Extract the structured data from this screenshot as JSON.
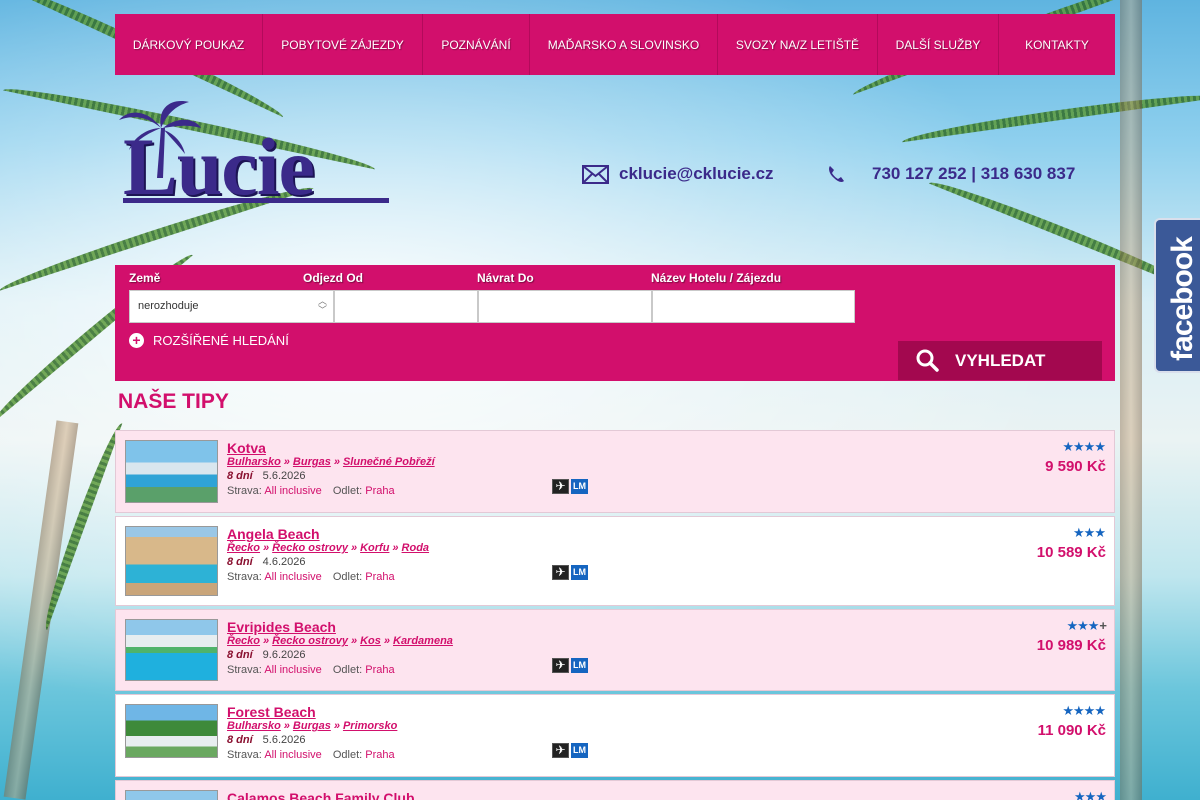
{
  "nav": {
    "items": [
      "DÁRKOVÝ POUKAZ",
      "POBYTOVÉ ZÁJEZDY",
      "POZNÁVÁNÍ",
      "MAĎARSKO A SLOVINSKO",
      "SVOZY NA/Z LETIŠTĚ",
      "DALŠÍ SLUŽBY",
      "KONTAKTY"
    ]
  },
  "logo": {
    "text": "Lucie"
  },
  "contact": {
    "email": "cklucie@cklucie.cz",
    "phone": "730 127 252 | 318 630 837"
  },
  "facebook": {
    "label": "facebook"
  },
  "search": {
    "labels": {
      "country": "Země",
      "depart": "Odjezd Od",
      "return": "Návrat Do",
      "hotel": "Název Hotelu / Zájezdu"
    },
    "country_value": "nerozhoduje",
    "advanced_label": "ROZŠÍŘENÉ HLEDÁNÍ",
    "button_label": "VYHLEDAT"
  },
  "tips": {
    "title": "NAŠE TIPY",
    "items": [
      {
        "name": "Kotva",
        "path": [
          "Bulharsko",
          "Burgas",
          "Slunečné Pobřeží"
        ],
        "days": "8 dní",
        "date": "5.6.2026",
        "board_label": "Strava:",
        "board": "All inclusive",
        "departure_label": "Odlet:",
        "departure": "Praha",
        "stars": "★★★★",
        "plus": "",
        "price": "9 590 Kč"
      },
      {
        "name": "Angela Beach",
        "path": [
          "Řecko",
          "Řecko ostrovy",
          "Korfu",
          "Roda"
        ],
        "days": "8 dní",
        "date": "4.6.2026",
        "board_label": "Strava:",
        "board": "All inclusive",
        "departure_label": "Odlet:",
        "departure": "Praha",
        "stars": "★★★",
        "plus": "",
        "price": "10 589 Kč"
      },
      {
        "name": "Evripides Beach",
        "path": [
          "Řecko",
          "Řecko ostrovy",
          "Kos",
          "Kardamena"
        ],
        "days": "8 dní",
        "date": "9.6.2026",
        "board_label": "Strava:",
        "board": "All inclusive",
        "departure_label": "Odlet:",
        "departure": "Praha",
        "stars": "★★★",
        "plus": "+",
        "price": "10 989 Kč"
      },
      {
        "name": "Forest Beach",
        "path": [
          "Bulharsko",
          "Burgas",
          "Primorsko"
        ],
        "days": "8 dní",
        "date": "5.6.2026",
        "board_label": "Strava:",
        "board": "All inclusive",
        "departure_label": "Odlet:",
        "departure": "Praha",
        "stars": "★★★★",
        "plus": "",
        "price": "11 090 Kč"
      },
      {
        "name": "Calamos Beach Family Club",
        "path": [],
        "days": "",
        "date": "",
        "board_label": "",
        "board": "",
        "departure_label": "",
        "departure": "",
        "stars": "★★★",
        "plus": "",
        "price": ""
      }
    ]
  },
  "icons": {
    "flight": "airplane-icon",
    "lastminute": "LM"
  },
  "colors": {
    "brand_pink": "#d20f6c",
    "brand_purple": "#3b2a8a",
    "facebook": "#3b5998",
    "star_blue": "#1565c0"
  }
}
